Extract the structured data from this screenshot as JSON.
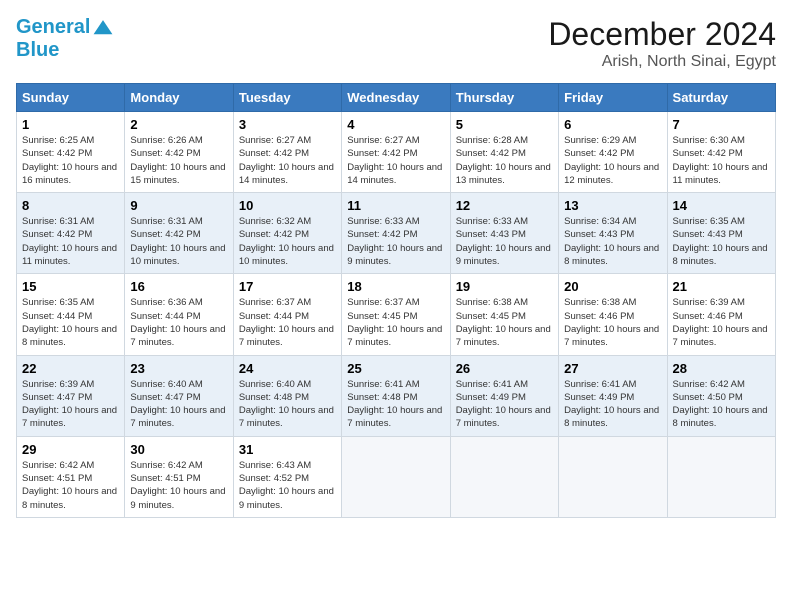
{
  "logo": {
    "line1": "General",
    "line2": "Blue"
  },
  "title": "December 2024",
  "location": "Arish, North Sinai, Egypt",
  "headers": [
    "Sunday",
    "Monday",
    "Tuesday",
    "Wednesday",
    "Thursday",
    "Friday",
    "Saturday"
  ],
  "weeks": [
    [
      {
        "day": "1",
        "sunrise": "6:25 AM",
        "sunset": "4:42 PM",
        "daylight": "10 hours and 16 minutes."
      },
      {
        "day": "2",
        "sunrise": "6:26 AM",
        "sunset": "4:42 PM",
        "daylight": "10 hours and 15 minutes."
      },
      {
        "day": "3",
        "sunrise": "6:27 AM",
        "sunset": "4:42 PM",
        "daylight": "10 hours and 14 minutes."
      },
      {
        "day": "4",
        "sunrise": "6:27 AM",
        "sunset": "4:42 PM",
        "daylight": "10 hours and 14 minutes."
      },
      {
        "day": "5",
        "sunrise": "6:28 AM",
        "sunset": "4:42 PM",
        "daylight": "10 hours and 13 minutes."
      },
      {
        "day": "6",
        "sunrise": "6:29 AM",
        "sunset": "4:42 PM",
        "daylight": "10 hours and 12 minutes."
      },
      {
        "day": "7",
        "sunrise": "6:30 AM",
        "sunset": "4:42 PM",
        "daylight": "10 hours and 11 minutes."
      }
    ],
    [
      {
        "day": "8",
        "sunrise": "6:31 AM",
        "sunset": "4:42 PM",
        "daylight": "10 hours and 11 minutes."
      },
      {
        "day": "9",
        "sunrise": "6:31 AM",
        "sunset": "4:42 PM",
        "daylight": "10 hours and 10 minutes."
      },
      {
        "day": "10",
        "sunrise": "6:32 AM",
        "sunset": "4:42 PM",
        "daylight": "10 hours and 10 minutes."
      },
      {
        "day": "11",
        "sunrise": "6:33 AM",
        "sunset": "4:42 PM",
        "daylight": "10 hours and 9 minutes."
      },
      {
        "day": "12",
        "sunrise": "6:33 AM",
        "sunset": "4:43 PM",
        "daylight": "10 hours and 9 minutes."
      },
      {
        "day": "13",
        "sunrise": "6:34 AM",
        "sunset": "4:43 PM",
        "daylight": "10 hours and 8 minutes."
      },
      {
        "day": "14",
        "sunrise": "6:35 AM",
        "sunset": "4:43 PM",
        "daylight": "10 hours and 8 minutes."
      }
    ],
    [
      {
        "day": "15",
        "sunrise": "6:35 AM",
        "sunset": "4:44 PM",
        "daylight": "10 hours and 8 minutes."
      },
      {
        "day": "16",
        "sunrise": "6:36 AM",
        "sunset": "4:44 PM",
        "daylight": "10 hours and 7 minutes."
      },
      {
        "day": "17",
        "sunrise": "6:37 AM",
        "sunset": "4:44 PM",
        "daylight": "10 hours and 7 minutes."
      },
      {
        "day": "18",
        "sunrise": "6:37 AM",
        "sunset": "4:45 PM",
        "daylight": "10 hours and 7 minutes."
      },
      {
        "day": "19",
        "sunrise": "6:38 AM",
        "sunset": "4:45 PM",
        "daylight": "10 hours and 7 minutes."
      },
      {
        "day": "20",
        "sunrise": "6:38 AM",
        "sunset": "4:46 PM",
        "daylight": "10 hours and 7 minutes."
      },
      {
        "day": "21",
        "sunrise": "6:39 AM",
        "sunset": "4:46 PM",
        "daylight": "10 hours and 7 minutes."
      }
    ],
    [
      {
        "day": "22",
        "sunrise": "6:39 AM",
        "sunset": "4:47 PM",
        "daylight": "10 hours and 7 minutes."
      },
      {
        "day": "23",
        "sunrise": "6:40 AM",
        "sunset": "4:47 PM",
        "daylight": "10 hours and 7 minutes."
      },
      {
        "day": "24",
        "sunrise": "6:40 AM",
        "sunset": "4:48 PM",
        "daylight": "10 hours and 7 minutes."
      },
      {
        "day": "25",
        "sunrise": "6:41 AM",
        "sunset": "4:48 PM",
        "daylight": "10 hours and 7 minutes."
      },
      {
        "day": "26",
        "sunrise": "6:41 AM",
        "sunset": "4:49 PM",
        "daylight": "10 hours and 7 minutes."
      },
      {
        "day": "27",
        "sunrise": "6:41 AM",
        "sunset": "4:49 PM",
        "daylight": "10 hours and 8 minutes."
      },
      {
        "day": "28",
        "sunrise": "6:42 AM",
        "sunset": "4:50 PM",
        "daylight": "10 hours and 8 minutes."
      }
    ],
    [
      {
        "day": "29",
        "sunrise": "6:42 AM",
        "sunset": "4:51 PM",
        "daylight": "10 hours and 8 minutes."
      },
      {
        "day": "30",
        "sunrise": "6:42 AM",
        "sunset": "4:51 PM",
        "daylight": "10 hours and 9 minutes."
      },
      {
        "day": "31",
        "sunrise": "6:43 AM",
        "sunset": "4:52 PM",
        "daylight": "10 hours and 9 minutes."
      },
      null,
      null,
      null,
      null
    ]
  ]
}
